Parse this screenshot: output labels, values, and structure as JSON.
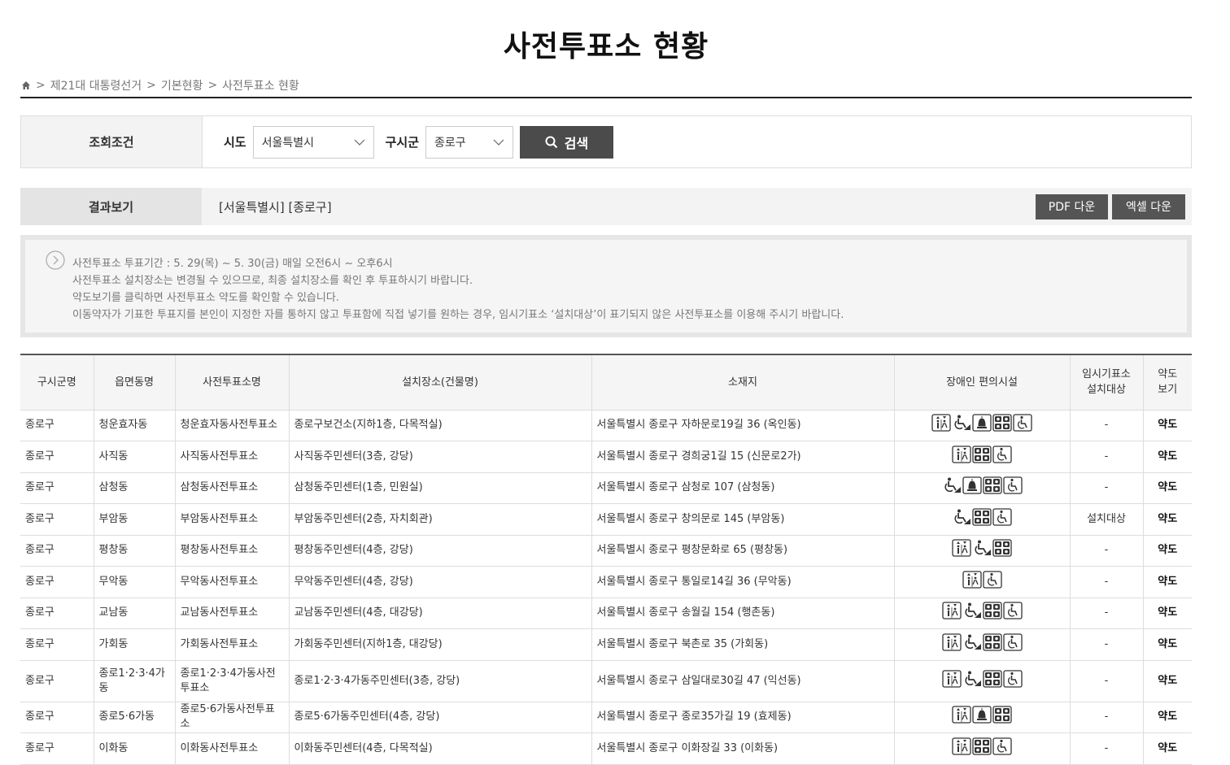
{
  "page_title": "사전투표소 현황",
  "breadcrumb": [
    "제21대 대통령선거",
    "기본현황",
    "사전투표소 현황"
  ],
  "search": {
    "label": "조회조건",
    "sido_label": "시도",
    "sido_value": "서울특별시",
    "gu_label": "구시군",
    "gu_value": "종로구",
    "button_label": "검색"
  },
  "result": {
    "label": "결과보기",
    "condition": "[서울특별시] [종로구]",
    "pdf_label": "PDF 다운",
    "excel_label": "엑셀 다운"
  },
  "notice": [
    "사전투표소 투표기간 : 5. 29(목) ~ 5. 30(금) 매일 오전6시 ~ 오후6시",
    "사전투표소 설치장소는 변경될 수 있으므로, 최종 설치장소를 확인 후 투표하시기 바랍니다.",
    "약도보기를 클릭하면 사전투표소 약도를 확인할 수 있습니다.",
    "이동약자가 기표한 투표지를 본인이 지정한 자를 통하지 않고 투표함에 직접 넣기를 원하는 경우, 임시기표소 ‘설치대상’이 표기되지 않은 사전투표소를 이용해 주시기 바랍니다."
  ],
  "table": {
    "headers": [
      "구시군명",
      "읍면동명",
      "사전투표소명",
      "설치장소(건물명)",
      "소재지",
      "장애인 편의시설",
      "임시기표소\n설치대상",
      "약도\n보기"
    ],
    "rows": [
      {
        "gu": "종로구",
        "dong": "청운효자동",
        "name": "청운효자동사전투표소",
        "place": "종로구보건소(지하1층, 다목적실)",
        "addr": "서울특별시 종로구 자하문로19길 36 (옥인동)",
        "icons": [
          "elevator-icon",
          "wheelchair-ramp-icon",
          "bell-icon",
          "braille-block-icon",
          "wheelchair-icon"
        ],
        "temp": "-",
        "map": "약도"
      },
      {
        "gu": "종로구",
        "dong": "사직동",
        "name": "사직동사전투표소",
        "place": "사직동주민센터(3층, 강당)",
        "addr": "서울특별시 종로구 경희궁1길 15 (신문로2가)",
        "icons": [
          "elevator-icon",
          "braille-block-icon",
          "wheelchair-icon"
        ],
        "temp": "-",
        "map": "약도"
      },
      {
        "gu": "종로구",
        "dong": "삼청동",
        "name": "삼청동사전투표소",
        "place": "삼청동주민센터(1층, 민원실)",
        "addr": "서울특별시 종로구 삼청로 107 (삼청동)",
        "icons": [
          "wheelchair-ramp-icon",
          "bell-icon",
          "braille-block-icon",
          "wheelchair-icon"
        ],
        "temp": "-",
        "map": "약도"
      },
      {
        "gu": "종로구",
        "dong": "부암동",
        "name": "부암동사전투표소",
        "place": "부암동주민센터(2층, 자치회관)",
        "addr": "서울특별시 종로구 창의문로 145 (부암동)",
        "icons": [
          "wheelchair-ramp-icon",
          "braille-block-icon",
          "wheelchair-icon"
        ],
        "temp": "설치대상",
        "map": "약도"
      },
      {
        "gu": "종로구",
        "dong": "평창동",
        "name": "평창동사전투표소",
        "place": "평창동주민센터(4층, 강당)",
        "addr": "서울특별시 종로구 평창문화로 65 (평창동)",
        "icons": [
          "elevator-icon",
          "wheelchair-ramp-icon",
          "braille-block-icon"
        ],
        "temp": "-",
        "map": "약도"
      },
      {
        "gu": "종로구",
        "dong": "무악동",
        "name": "무악동사전투표소",
        "place": "무악동주민센터(4층, 강당)",
        "addr": "서울특별시 종로구 통일로14길 36 (무악동)",
        "icons": [
          "elevator-icon",
          "wheelchair-icon"
        ],
        "temp": "-",
        "map": "약도"
      },
      {
        "gu": "종로구",
        "dong": "교남동",
        "name": "교남동사전투표소",
        "place": "교남동주민센터(4층, 대강당)",
        "addr": "서울특별시 종로구 송월길 154 (행촌동)",
        "icons": [
          "elevator-icon",
          "wheelchair-ramp-icon",
          "braille-block-icon",
          "wheelchair-icon"
        ],
        "temp": "-",
        "map": "약도"
      },
      {
        "gu": "종로구",
        "dong": "가회동",
        "name": "가회동사전투표소",
        "place": "가회동주민센터(지하1층, 대강당)",
        "addr": "서울특별시 종로구 북촌로 35 (가회동)",
        "icons": [
          "elevator-icon",
          "wheelchair-ramp-icon",
          "braille-block-icon",
          "wheelchair-icon"
        ],
        "temp": "-",
        "map": "약도"
      },
      {
        "gu": "종로구",
        "dong": "종로1·2·3·4가동",
        "name": "종로1·2·3·4가동사전투표소",
        "place": "종로1·2·3·4가동주민센터(3층, 강당)",
        "addr": "서울특별시 종로구 삼일대로30길 47 (익선동)",
        "icons": [
          "elevator-icon",
          "wheelchair-ramp-icon",
          "braille-block-icon",
          "wheelchair-icon"
        ],
        "temp": "-",
        "map": "약도",
        "tall": true
      },
      {
        "gu": "종로구",
        "dong": "종로5·6가동",
        "name": "종로5·6가동사전투표소",
        "place": "종로5·6가동주민센터(4층, 강당)",
        "addr": "서울특별시 종로구 종로35가길 19 (효제동)",
        "icons": [
          "elevator-icon",
          "bell-icon",
          "braille-block-icon"
        ],
        "temp": "-",
        "map": "약도"
      },
      {
        "gu": "종로구",
        "dong": "이화동",
        "name": "이화동사전투표소",
        "place": "이화동주민센터(4층, 다목적실)",
        "addr": "서울특별시 종로구 이화장길 33 (이화동)",
        "icons": [
          "elevator-icon",
          "braille-block-icon",
          "wheelchair-icon"
        ],
        "temp": "-",
        "map": "약도"
      }
    ]
  }
}
